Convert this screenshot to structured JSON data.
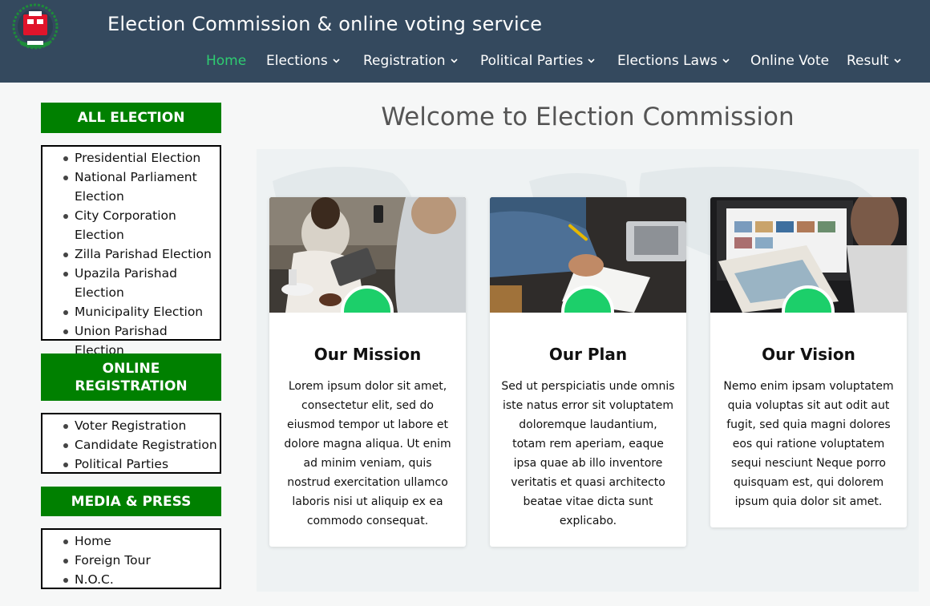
{
  "header": {
    "title": "Election Commission & online voting service",
    "logo_icon": "election-commission-logo-icon"
  },
  "nav": {
    "items": [
      {
        "label": "Home",
        "active": true,
        "dropdown": false
      },
      {
        "label": "Elections",
        "active": false,
        "dropdown": true
      },
      {
        "label": "Registration",
        "active": false,
        "dropdown": true
      },
      {
        "label": "Political Parties",
        "active": false,
        "dropdown": true
      },
      {
        "label": "Elections Laws",
        "active": false,
        "dropdown": true
      },
      {
        "label": "Online Vote",
        "active": false,
        "dropdown": false
      },
      {
        "label": "Result",
        "active": false,
        "dropdown": true
      }
    ]
  },
  "sidebar": {
    "all_election": {
      "heading": "ALL ELECTION",
      "items": [
        "Presidential Election",
        "National Parliament Election",
        "City Corporation Election",
        "Zilla Parishad Election",
        "Upazila Parishad Election",
        "Municipality Election",
        "Union Parishad Election"
      ]
    },
    "online_registration": {
      "heading": "ONLINE REGISTRATION",
      "items": [
        "Voter Registration",
        "Candidate Registration",
        "Political Parties"
      ]
    },
    "media_press": {
      "heading": "MEDIA & PRESS",
      "items": [
        "Home",
        "Foreign Tour",
        "N.O.C."
      ]
    }
  },
  "main": {
    "welcome": "Welcome to Election Commission",
    "cards": [
      {
        "title": "Our Mission",
        "text": "Lorem ipsum dolor sit amet, consectetur elit, sed do eiusmod tempor ut labore et dolore magna aliqua. Ut enim ad minim veniam, quis nostrud exercitation ullamco laboris nisi ut aliquip ex ea commodo consequat."
      },
      {
        "title": "Our Plan",
        "text": "Sed ut perspiciatis unde omnis iste natus error sit voluptatem doloremque laudantium, totam rem aperiam, eaque ipsa quae ab illo inventore veritatis et quasi architecto beatae vitae dicta sunt explicabo."
      },
      {
        "title": "Our Vision",
        "text": "Nemo enim ipsam voluptatem quia voluptas sit aut odit aut fugit, sed quia magni dolores eos qui ratione voluptatem sequi nesciunt Neque porro quisquam est, qui dolorem ipsum quia dolor sit amet."
      }
    ]
  },
  "colors": {
    "header_bg": "#34495e",
    "nav_active": "#2ecc71",
    "sidebar_heading_bg": "#008000",
    "card_circle": "#1ccf6a"
  }
}
